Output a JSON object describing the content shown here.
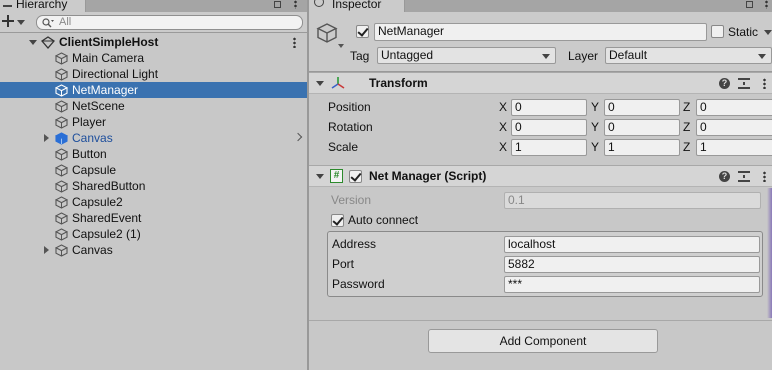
{
  "hierarchy": {
    "tab_label": "Hierarchy",
    "search_placeholder": "All",
    "scene_name": "ClientSimpleHost",
    "items": [
      {
        "label": "Main Camera",
        "type": "object"
      },
      {
        "label": "Directional Light",
        "type": "object"
      },
      {
        "label": "NetManager",
        "type": "object",
        "selected": true
      },
      {
        "label": "NetScene",
        "type": "object"
      },
      {
        "label": "Player",
        "type": "object"
      },
      {
        "label": "Canvas",
        "type": "prefab",
        "expandable": true
      },
      {
        "label": "Button",
        "type": "object"
      },
      {
        "label": "Capsule",
        "type": "object"
      },
      {
        "label": "SharedButton",
        "type": "object"
      },
      {
        "label": "Capsule2",
        "type": "object"
      },
      {
        "label": "SharedEvent",
        "type": "object"
      },
      {
        "label": "Capsule2 (1)",
        "type": "object"
      },
      {
        "label": "Canvas",
        "type": "object",
        "expandable": true
      }
    ]
  },
  "inspector": {
    "tab_label": "Inspector",
    "object_name": "NetManager",
    "static_label": "Static",
    "tag_label": "Tag",
    "tag_value": "Untagged",
    "layer_label": "Layer",
    "layer_value": "Default",
    "transform": {
      "title": "Transform",
      "rows": [
        {
          "label": "Position",
          "x": "0",
          "y": "0",
          "z": "0"
        },
        {
          "label": "Rotation",
          "x": "0",
          "y": "0",
          "z": "0"
        },
        {
          "label": "Scale",
          "x": "1",
          "y": "1",
          "z": "1"
        }
      ],
      "axis_labels": {
        "x": "X",
        "y": "Y",
        "z": "Z"
      }
    },
    "script": {
      "title": "Net Manager (Script)",
      "version_label": "Version",
      "version_value": "0.1",
      "auto_connect_label": "Auto connect",
      "auto_connect": true,
      "fields": [
        {
          "label": "Address",
          "value": "localhost"
        },
        {
          "label": "Port",
          "value": "5882"
        },
        {
          "label": "Password",
          "value": "***"
        }
      ]
    },
    "add_component_label": "Add Component"
  },
  "colors": {
    "selection": "#3a72b0",
    "prefab_text": "#1d4e9c",
    "panel_bg": "#c8c8c8"
  }
}
